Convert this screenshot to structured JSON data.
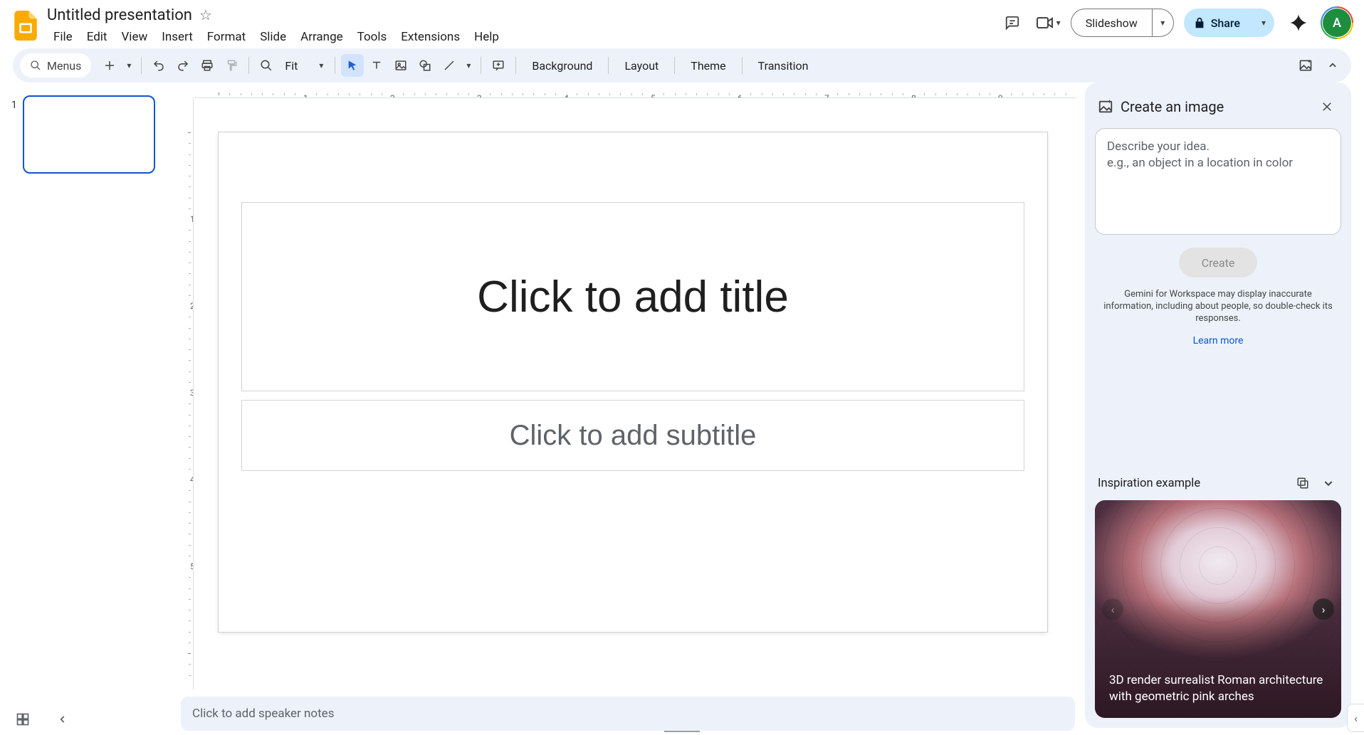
{
  "app": {
    "doc_title": "Untitled presentation"
  },
  "menubar": {
    "items": [
      "File",
      "Edit",
      "View",
      "Insert",
      "Format",
      "Slide",
      "Arrange",
      "Tools",
      "Extensions",
      "Help"
    ]
  },
  "header_buttons": {
    "slideshow": "Slideshow",
    "share": "Share"
  },
  "avatar": {
    "initial": "A"
  },
  "toolbar": {
    "menus_label": "Menus",
    "zoom_label": "Fit",
    "background": "Background",
    "layout": "Layout",
    "theme": "Theme",
    "transition": "Transition"
  },
  "filmstrip": {
    "slides": [
      {
        "number": "1"
      }
    ]
  },
  "canvas": {
    "title_placeholder": "Click to add title",
    "subtitle_placeholder": "Click to add subtitle"
  },
  "ruler": {
    "h_labels": [
      "1",
      "2",
      "3",
      "4",
      "5",
      "6",
      "7",
      "8",
      "9"
    ],
    "v_labels": [
      "1",
      "2",
      "3",
      "4",
      "5"
    ]
  },
  "notes": {
    "placeholder": "Click to add speaker notes"
  },
  "sidepanel": {
    "title": "Create an image",
    "prompt_placeholder": "Describe your idea.\ne.g., an object in a location in color",
    "create_label": "Create",
    "disclaimer": "Gemini for Workspace may display inaccurate information, including about people, so double-check its responses.",
    "learn_more": "Learn more",
    "inspiration_title": "Inspiration example",
    "inspiration_caption": "3D render surrealist Roman architecture with geometric pink arches"
  }
}
